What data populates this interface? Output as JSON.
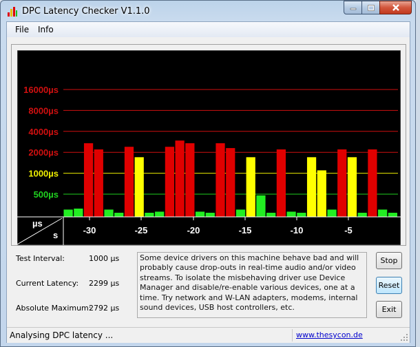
{
  "window": {
    "title": "DPC Latency Checker V1.1.0"
  },
  "menu": [
    {
      "label": "File"
    },
    {
      "label": "Info"
    }
  ],
  "chart_data": {
    "type": "bar",
    "y_scale": "log2",
    "y_ticks": [
      "16000µs",
      "8000µs",
      "4000µs",
      "2000µs",
      "1000µs",
      "500µs"
    ],
    "y_tick_values": [
      16000,
      8000,
      4000,
      2000,
      1000,
      500
    ],
    "x_ticks": [
      "-30",
      "-25",
      "-20",
      "-15",
      "-10",
      "-5"
    ],
    "xlabel": "s",
    "ylabel": "µs",
    "colors": {
      "green": "#22ee22",
      "yellow": "#ffff00",
      "red": "#e00000"
    },
    "values": [
      300,
      310,
      2700,
      2200,
      300,
      270,
      2400,
      1700,
      270,
      280,
      2400,
      2950,
      2700,
      280,
      270,
      2700,
      2300,
      300,
      1700,
      480,
      270,
      2200,
      280,
      270,
      1700,
      1100,
      300,
      2200,
      1700,
      270,
      2200,
      300,
      270
    ],
    "bar_colors": [
      "green",
      "green",
      "red",
      "red",
      "green",
      "green",
      "red",
      "yellow",
      "green",
      "green",
      "red",
      "red",
      "red",
      "green",
      "green",
      "red",
      "red",
      "green",
      "yellow",
      "green",
      "green",
      "red",
      "green",
      "green",
      "yellow",
      "yellow",
      "green",
      "red",
      "yellow",
      "green",
      "red",
      "green",
      "green"
    ]
  },
  "info": {
    "test_interval_label": "Test Interval:",
    "test_interval_value": "1000 µs",
    "current_latency_label": "Current Latency:",
    "current_latency_value": "2299 µs",
    "absolute_max_label": "Absolute Maximum:",
    "absolute_max_value": "2792 µs"
  },
  "description": "Some device drivers on this machine behave bad and will probably cause drop-outs in real-time audio and/or video streams. To isolate the misbehaving driver use Device Manager and disable/re-enable various devices, one at a time. Try network and W-LAN adapters, modems, internal sound devices, USB host controllers, etc.",
  "buttons": {
    "stop": "Stop",
    "reset": "Reset",
    "exit": "Exit"
  },
  "status": {
    "text": "Analysing DPC latency ...",
    "link": "www.thesycon.de"
  }
}
